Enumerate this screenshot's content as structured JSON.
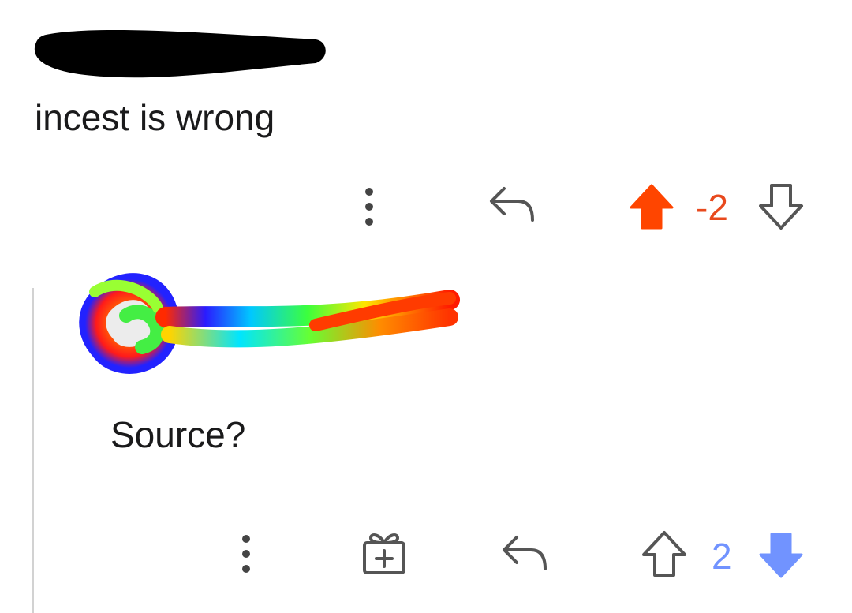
{
  "parent_comment": {
    "body": "incest is wrong",
    "score": "-2",
    "vote_state": "upvoted",
    "colors": {
      "upvoted": "#ff4500"
    }
  },
  "reply_comment": {
    "body": "Source?",
    "score": "2",
    "vote_state": "downvoted",
    "colors": {
      "downvoted": "#7193ff"
    }
  },
  "icons": {
    "more": "more-vertical-icon",
    "reply": "reply-arrow-icon",
    "award": "gift-award-icon",
    "upvote": "upvote-arrow-icon",
    "downvote": "downvote-arrow-icon"
  }
}
